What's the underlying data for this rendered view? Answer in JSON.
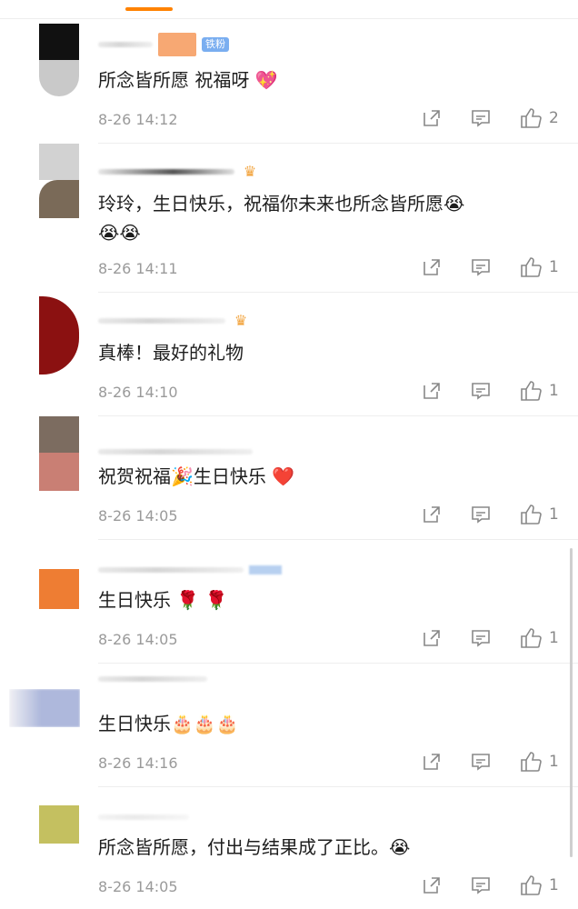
{
  "comments": [
    {
      "text": "所念皆所愿 祝福呀",
      "emoji": "💖",
      "time": "8-26 14:12",
      "likes": "2",
      "badge": "铁粉"
    },
    {
      "text": "玲玲，生日快乐，祝福你未来也所念皆所愿",
      "emoji": "😭",
      "emoji2": "😭😭",
      "time": "8-26 14:11",
      "likes": "1",
      "badge": "♛"
    },
    {
      "text": "真棒！最好的礼物",
      "time": "8-26 14:10",
      "likes": "1",
      "badge": "♛"
    },
    {
      "text": "祝贺祝福",
      "emoji": "🎉",
      "text2": "生日快乐",
      "emoji3": "❤️",
      "time": "8-26 14:05",
      "likes": "1"
    },
    {
      "text": "生日快乐",
      "emoji": "🌹 🌹",
      "time": "8-26 14:05",
      "likes": "1"
    },
    {
      "text": "生日快乐",
      "emoji": "🎂🎂🎂",
      "time": "8-26 14:16",
      "likes": "1"
    },
    {
      "text": "所念皆所愿，付出与结果成了正比。",
      "emoji": "😭",
      "time": "8-26 14:05",
      "likes": "1"
    }
  ],
  "colors": {
    "accent": "#ff8200",
    "avatar1": [
      "#111111",
      "#c8c8c8"
    ],
    "avatar2": [
      "#d0d0d0",
      "#7a6a5a"
    ],
    "avatar3": [
      "#8b1111"
    ],
    "avatar4": [
      "#7c6c60",
      "#c97f74"
    ],
    "avatar5": [
      "#ee7d33"
    ],
    "avatar6": [
      "#aeb8dc"
    ],
    "avatar7": [
      "#c4c060"
    ]
  },
  "icons": {
    "share": "share-icon",
    "comment": "comment-icon",
    "like": "thumbs-up-icon"
  }
}
